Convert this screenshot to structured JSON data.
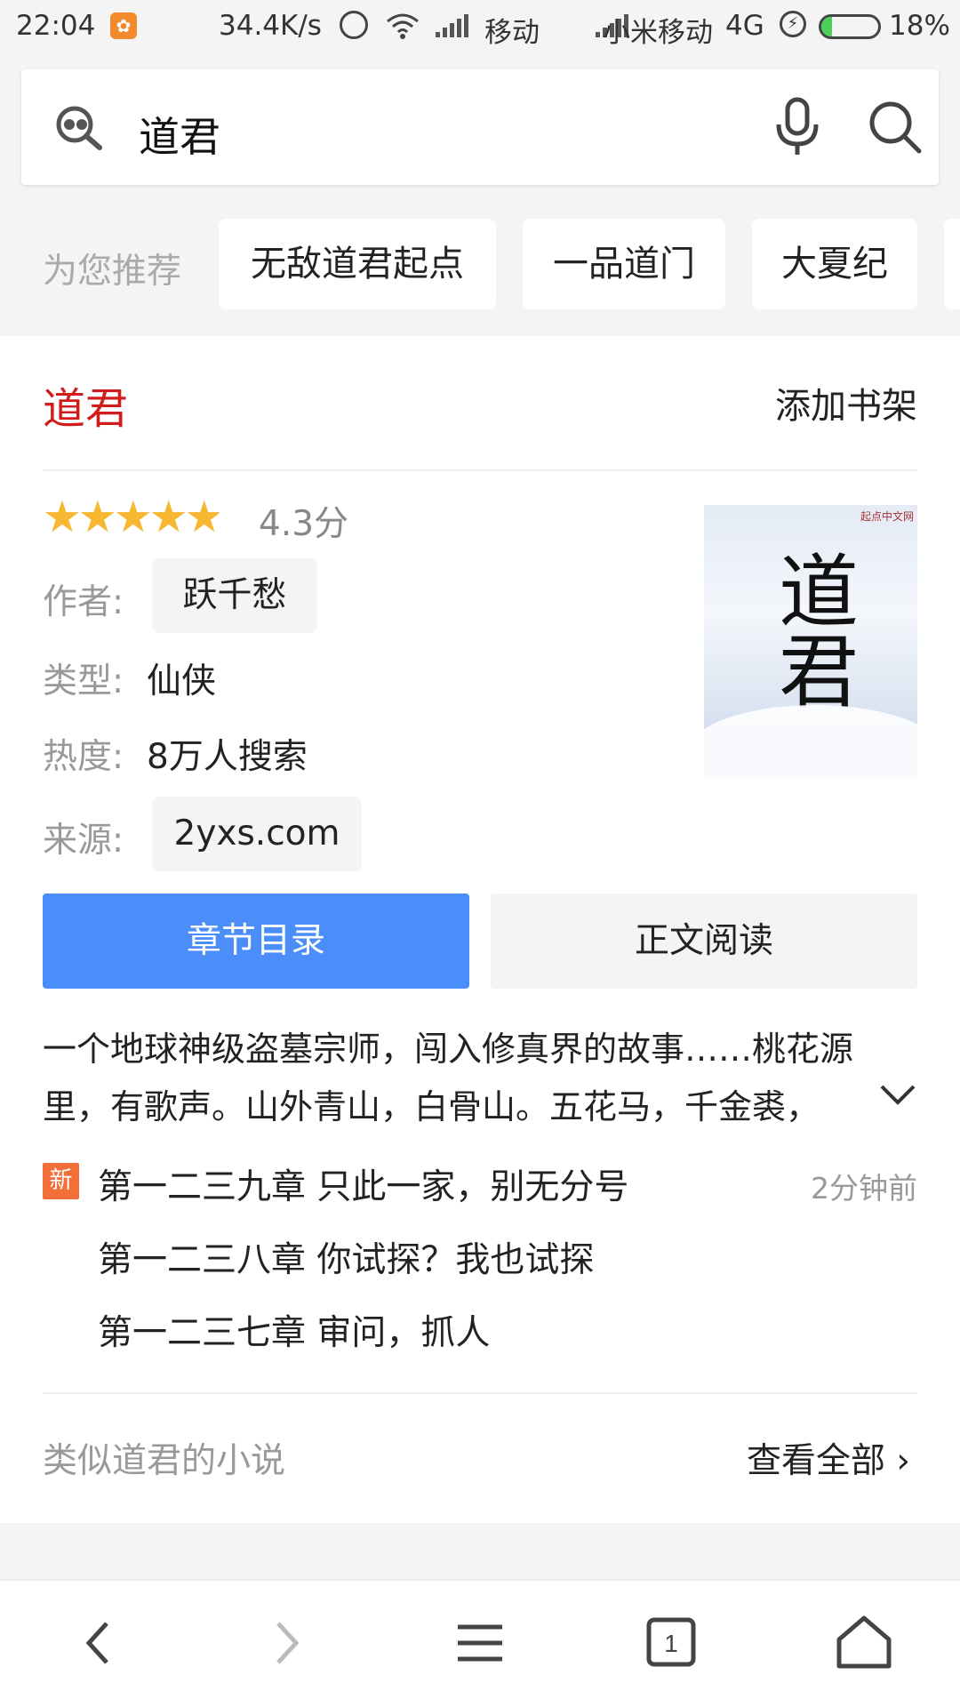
{
  "status_bar": {
    "time": "22:04",
    "app_icon": "uc-browser-icon",
    "net_speed": "34.4K/s",
    "carrier1": "移动",
    "carrier2": "小米移动",
    "network": "4G",
    "battery_percent": "18%",
    "battery_level": 0.18
  },
  "search": {
    "query": "道君",
    "logo_icon": "search-engine-logo-icon",
    "mic_icon": "microphone-icon",
    "search_icon": "search-icon"
  },
  "recommend": {
    "label": "为您推荐",
    "items": [
      "无敌道君起点",
      "一品道门",
      "大夏纪"
    ]
  },
  "book": {
    "title": "道君",
    "add_shelf": "添加书架",
    "rating_value": 4.3,
    "rating_text": "4.3分",
    "author_label": "作者:",
    "author": "跃千愁",
    "genre_label": "类型:",
    "genre": "仙侠",
    "heat_label": "热度:",
    "heat": "8万人搜索",
    "source_label": "来源:",
    "source": "2yxs.com",
    "cover": {
      "title_art": "道君",
      "badge": "起点中文网"
    },
    "btn_catalog": "章节目录",
    "btn_read": "正文阅读",
    "synopsis": "一个地球神级盗墓宗师，闯入修真界的故事……桃花源里，有歌声。山外青山，白骨山。五花马，千金裘，",
    "new_badge": "新",
    "chapters": [
      {
        "title": "第一二三九章 只此一家，别无分号",
        "time": "2分钟前"
      },
      {
        "title": "第一二三八章 你试探？我也试探"
      },
      {
        "title": "第一二三七章 审问，抓人"
      }
    ],
    "similar_label": "类似道君的小说",
    "view_all": "查看全部"
  },
  "colors": {
    "accent_blue": "#4b8ef9",
    "title_red": "#d01c1c",
    "star": "#f7b731",
    "new_badge": "#f26f3a"
  },
  "bottom_nav": {
    "icons": [
      "back-icon",
      "forward-icon",
      "menu-icon",
      "tabs-icon",
      "home-icon"
    ],
    "tab_count": "1"
  }
}
